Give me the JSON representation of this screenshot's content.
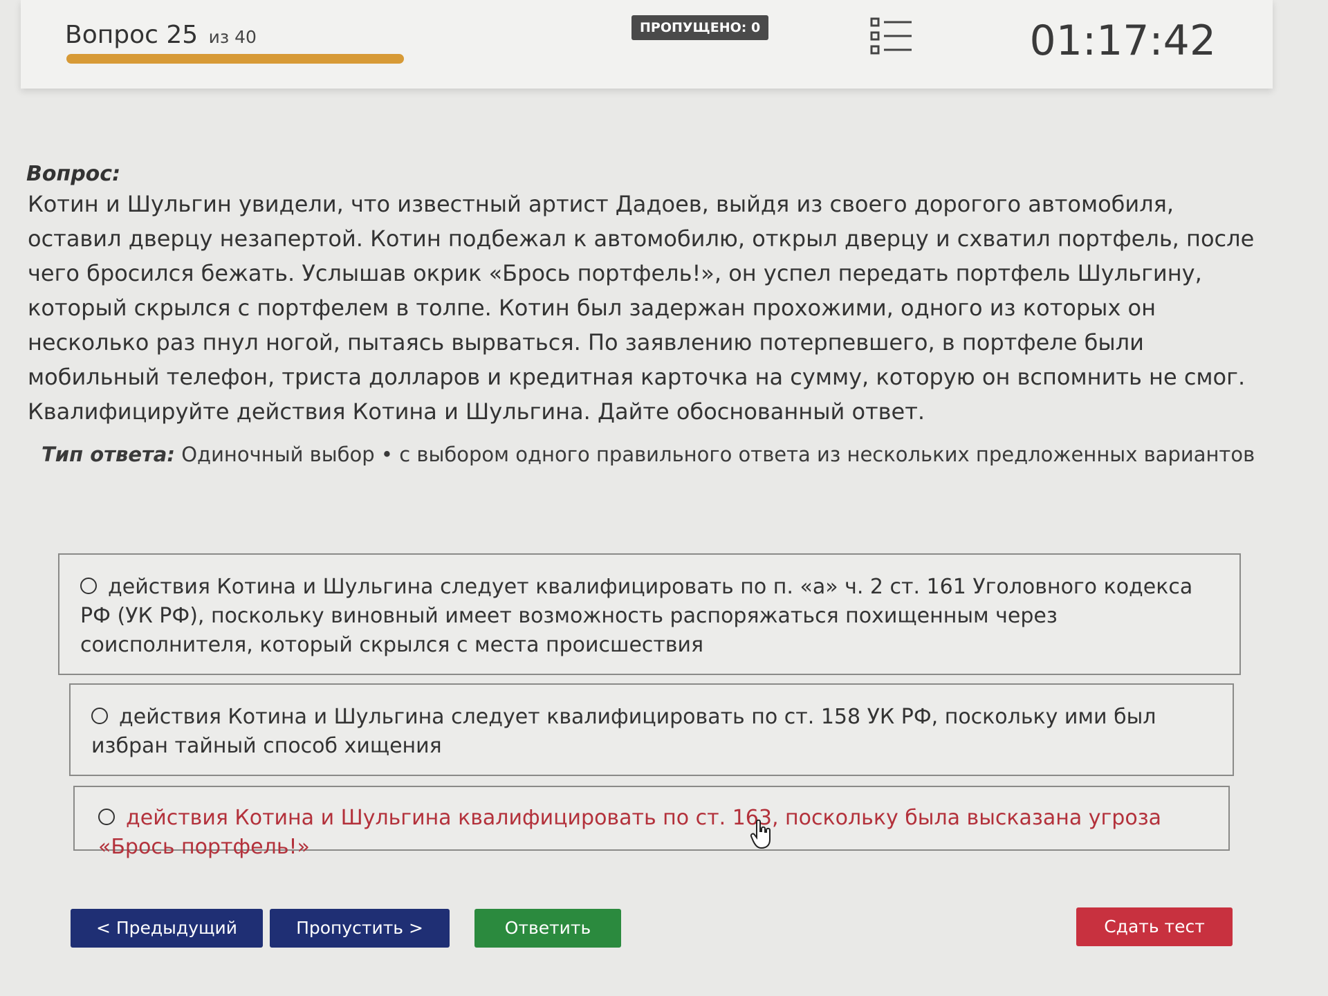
{
  "header": {
    "question_label": "Вопрос 25",
    "question_of": "из 40",
    "progress_fraction": 0.375,
    "skipped_badge": "ПРОПУЩЕНО: 0",
    "timer": "01:17:42"
  },
  "question": {
    "label": "Вопрос:",
    "text": "Котин и Шульгин увидели, что известный артист Дадоев, выйдя из своего дорогого автомобиля, оставил дверцу незапертой. Котин подбежал к автомобилю, открыл дверцу и схватил портфель, после чего бросился бежать. Услышав окрик «Брось портфель!», он успел передать портфель Шульгину, который скрылся с портфелем в толпе. Котин был задержан прохожими, одного из которых он несколько раз пнул ногой, пытаясь вырваться. По заявлению потерпевшего, в портфеле были мобильный телефон, триста долларов и кредитная карточка на сумму, которую он вспомнить не смог. Квалифицируйте действия Котина и Шульгина. Дайте обоснованный ответ.",
    "answer_type_label": "Тип ответа:",
    "answer_type_value": "Одиночный выбор • с выбором одного правильного ответа из нескольких предложенных вариантов"
  },
  "options": [
    {
      "text": "действия Котина и Шульгина следует квалифицировать по п. «а» ч. 2 ст. 161 Уголовного кодекса РФ (УК РФ), поскольку виновный имеет возможность распоряжаться похищенным через соисполнителя, который скрылся с места происшествия"
    },
    {
      "text": "действия Котина и Шульгина следует квалифицировать по ст. 158 УК РФ, поскольку ими был избран тайный способ хищения"
    },
    {
      "text": "действия Котина и Шульгина квалифицировать по ст. 163, поскольку была высказана угроза «Брось портфель!»",
      "hover_color": "#b3313b"
    }
  ],
  "buttons": {
    "prev": "< Предыдущий",
    "skip": "Пропустить >",
    "answer": "Ответить",
    "submit": "Сдать тест"
  },
  "colors": {
    "progress": "#d79a36",
    "nav_button": "#1f2f74",
    "answer_button": "#2b8a3e",
    "submit_button": "#c8313f"
  },
  "icons": {
    "question_list": "list-icon",
    "cursor": "hand-pointer-icon"
  }
}
